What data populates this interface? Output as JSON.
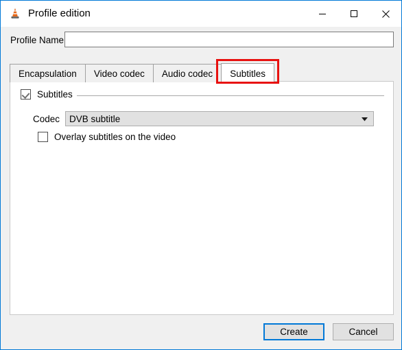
{
  "window": {
    "title": "Profile edition",
    "icon": "vlc-cone-icon",
    "accent_color": "#0078d7",
    "background_color": "#f0f0f0",
    "titlebar_color": "#ffffff",
    "controls": {
      "minimize": "minimize-icon",
      "maximize": "maximize-icon",
      "close": "close-icon"
    }
  },
  "profile": {
    "label": "Profile Name",
    "value": "",
    "placeholder": ""
  },
  "tabs": [
    {
      "label": "Encapsulation",
      "active": false
    },
    {
      "label": "Video codec",
      "active": false
    },
    {
      "label": "Audio codec",
      "active": false
    },
    {
      "label": "Subtitles",
      "active": true
    }
  ],
  "annotation": {
    "target": "Subtitles",
    "color": "#e8110f"
  },
  "subtitles_panel": {
    "group": {
      "label": "Subtitles",
      "checked": true
    },
    "codec": {
      "label": "Codec",
      "value": "DVB subtitle",
      "arrow_icon": "chevron-down-icon"
    },
    "overlay": {
      "label": "Overlay subtitles on the video",
      "checked": false
    }
  },
  "footer": {
    "create_label": "Create",
    "cancel_label": "Cancel"
  }
}
